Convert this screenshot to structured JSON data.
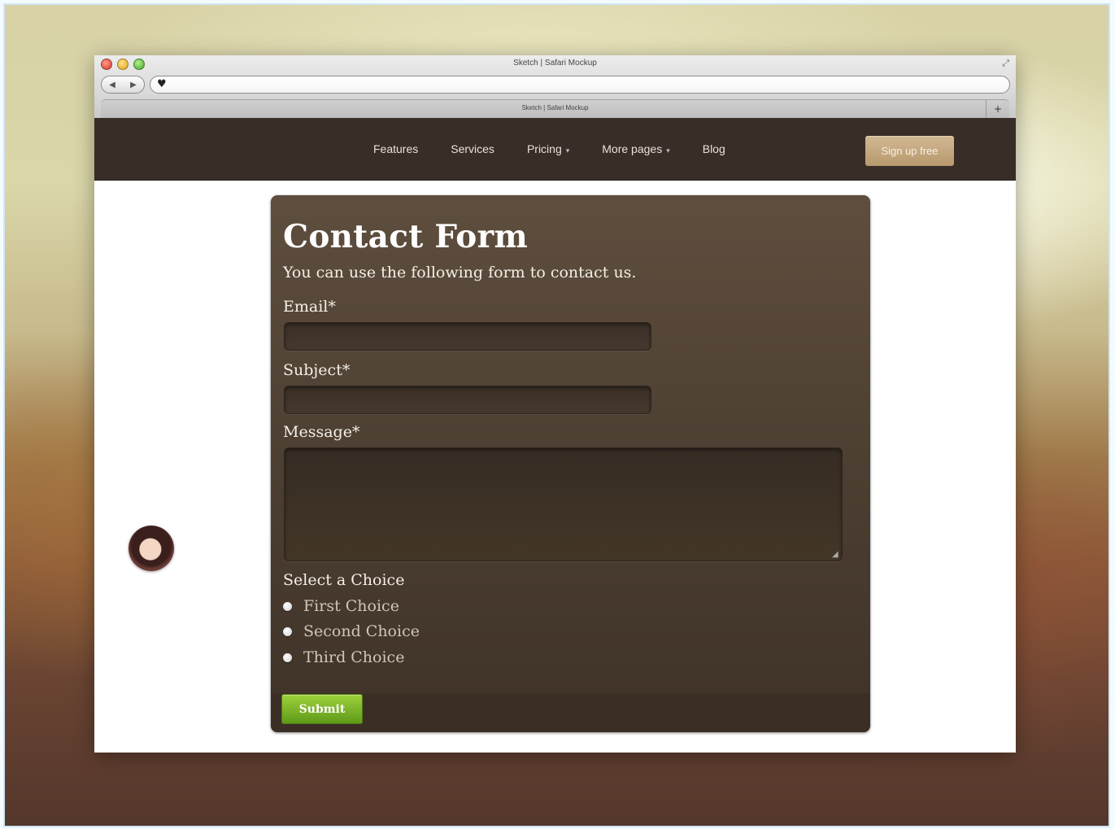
{
  "browser": {
    "window_title": "Sketch | Safari Mockup",
    "tab_title": "Sketch | Safari Mockup",
    "back_glyph": "◀",
    "forward_glyph": "▶",
    "url_icon": "♥",
    "new_tab_glyph": "+",
    "expand_glyph": "⤢"
  },
  "nav": {
    "items": [
      {
        "label": "Features"
      },
      {
        "label": "Services"
      },
      {
        "label": "Pricing",
        "caret": "▾"
      },
      {
        "label": "More pages",
        "caret": "▾"
      },
      {
        "label": "Blog"
      }
    ],
    "signup_label": "Sign up free"
  },
  "form": {
    "title": "Contact Form",
    "intro": "You can use the following form to contact us.",
    "email_label": "Email*",
    "subject_label": "Subject*",
    "message_label": "Message*",
    "email_value": "",
    "subject_value": "",
    "message_value": "",
    "choice_heading": "Select a Choice",
    "choices": [
      "First Choice",
      "Second Choice",
      "Third Choice"
    ],
    "submit_label": "Submit"
  },
  "colors": {
    "nav_bg": "#382d27",
    "card_bg": "#4e4033",
    "signup_bg": "#c6a97f",
    "submit_bg": "#7bb52a"
  },
  "icons": {
    "traffic_lights": [
      "close-icon",
      "minimize-icon",
      "zoom-icon"
    ],
    "url_icon": "heart-icon",
    "resize_icon": "resize-handle-icon",
    "avatar": "user-avatar"
  }
}
